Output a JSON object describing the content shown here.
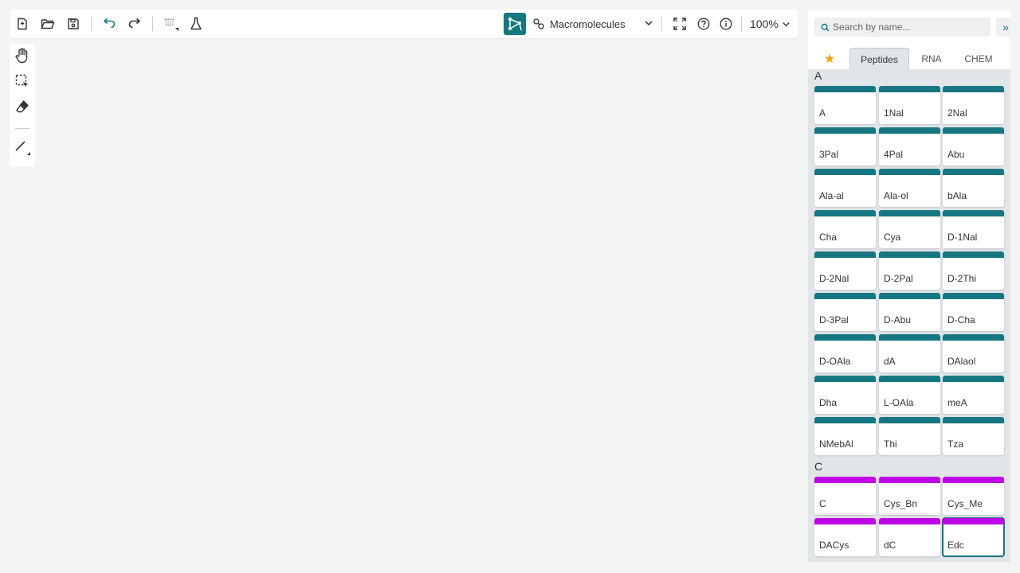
{
  "toolbar": {
    "mode_label": "Macromolecules",
    "zoom_label": "100%"
  },
  "icons": [
    "new-file-icon",
    "open-icon",
    "save-icon",
    "undo-icon",
    "redo-icon",
    "attach-icon",
    "chemistry-icon",
    "macromolecules-mode-icon",
    "chevron-down-icon",
    "fullscreen-icon",
    "help-icon",
    "info-icon",
    "hand-icon",
    "select-rect-icon",
    "eraser-icon",
    "bond-single-icon",
    "search-icon",
    "double-chevron-right-icon",
    "star-icon"
  ],
  "colors": {
    "accent": "#167782",
    "peptide_bar": "#167782",
    "cysteine_bar": "#bf04e5",
    "favorite_star": "#f0a30a"
  },
  "panel": {
    "search_placeholder": "Search by name...",
    "collapse_label": "»",
    "tabs": [
      {
        "label": "★"
      },
      {
        "label": "Peptides"
      },
      {
        "label": "RNA"
      },
      {
        "label": "CHEM"
      }
    ],
    "active_tab": "Peptides",
    "groups": [
      {
        "letter": "A",
        "items": [
          {
            "name": "A"
          },
          {
            "name": "1Nal"
          },
          {
            "name": "2Nal"
          },
          {
            "name": "3Pal"
          },
          {
            "name": "4Pal"
          },
          {
            "name": "Abu"
          },
          {
            "name": "Ala-al"
          },
          {
            "name": "Ala-ol"
          },
          {
            "name": "bAla"
          },
          {
            "name": "Cha"
          },
          {
            "name": "Cya"
          },
          {
            "name": "D-1Nal"
          },
          {
            "name": "D-2Nal"
          },
          {
            "name": "D-2Pal"
          },
          {
            "name": "D-2Thi"
          },
          {
            "name": "D-3Pal"
          },
          {
            "name": "D-Abu"
          },
          {
            "name": "D-Cha"
          },
          {
            "name": "D-OAla"
          },
          {
            "name": "dA"
          },
          {
            "name": "DAlaol"
          },
          {
            "name": "Dha"
          },
          {
            "name": "L-OAla"
          },
          {
            "name": "meA"
          },
          {
            "name": "NMebAl"
          },
          {
            "name": "Thi"
          },
          {
            "name": "Tza"
          }
        ]
      },
      {
        "letter": "C",
        "items": [
          {
            "name": "C"
          },
          {
            "name": "Cys_Bn"
          },
          {
            "name": "Cys_Me"
          },
          {
            "name": "DACys"
          },
          {
            "name": "dC"
          },
          {
            "name": "Edc",
            "selected": true
          }
        ]
      }
    ]
  }
}
